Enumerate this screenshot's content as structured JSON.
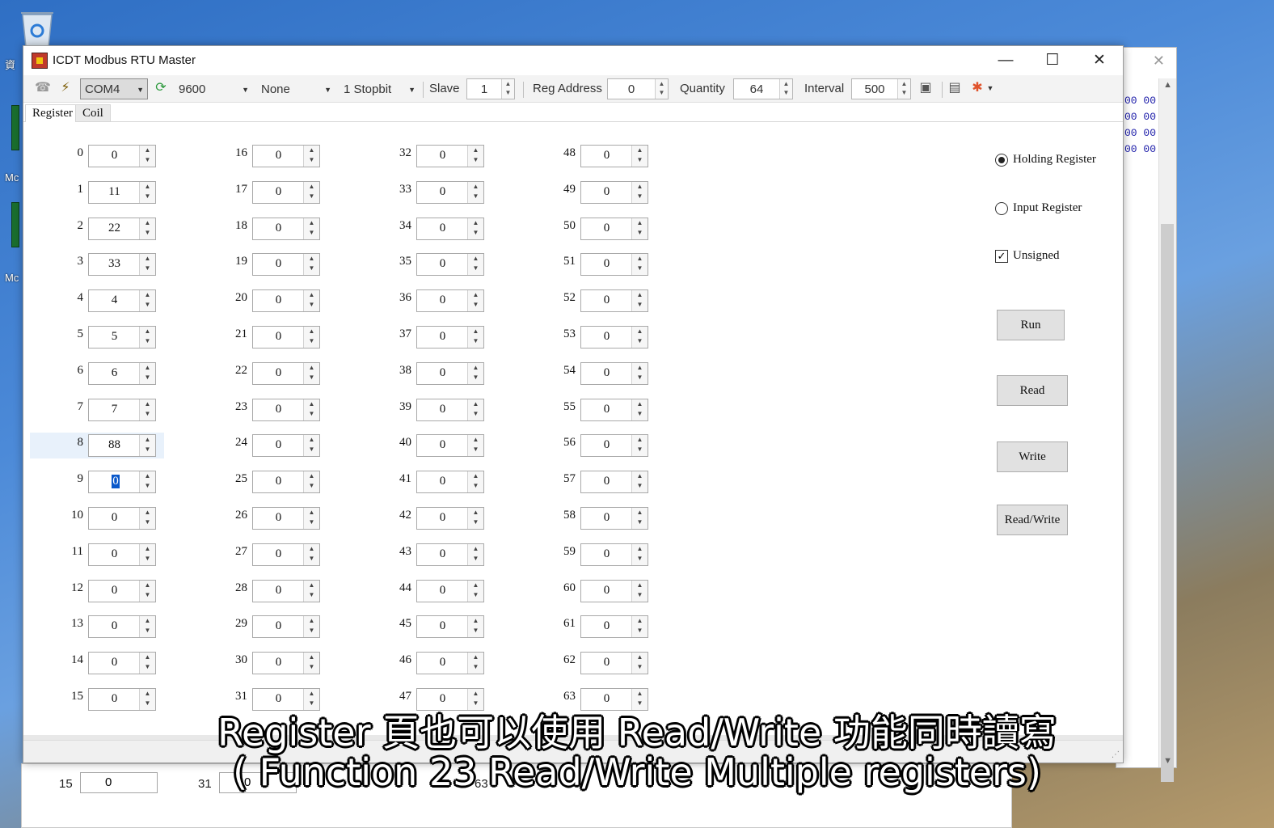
{
  "desktop": {
    "labels": [
      "資",
      "Mc",
      "Mc"
    ]
  },
  "bg_window": {
    "hex_lines": [
      "00 00",
      "00 00",
      "00 00",
      "00 00"
    ]
  },
  "behind_window": {
    "label_a": "15",
    "value_a": "0",
    "label_b": "31",
    "value_b": "0",
    "label_c": "63"
  },
  "window": {
    "title": "ICDT Modbus RTU Master",
    "controls": {
      "minimize": "—",
      "maximize": "☐",
      "close": "✕"
    }
  },
  "toolbar": {
    "port": "COM4",
    "baud": "9600",
    "parity": "None",
    "stopbit": "1 Stopbit",
    "slave_label": "Slave",
    "slave_value": "1",
    "reg_address_label": "Reg Address",
    "reg_address_value": "0",
    "quantity_label": "Quantity",
    "quantity_value": "64",
    "interval_label": "Interval",
    "interval_value": "500"
  },
  "tabs": [
    {
      "label": "Register",
      "active": true
    },
    {
      "label": "Coil",
      "active": false
    }
  ],
  "registers": [
    {
      "addr": "0",
      "value": "0"
    },
    {
      "addr": "1",
      "value": "11"
    },
    {
      "addr": "2",
      "value": "22"
    },
    {
      "addr": "3",
      "value": "33"
    },
    {
      "addr": "4",
      "value": "4"
    },
    {
      "addr": "5",
      "value": "5"
    },
    {
      "addr": "6",
      "value": "6"
    },
    {
      "addr": "7",
      "value": "7"
    },
    {
      "addr": "8",
      "value": "88"
    },
    {
      "addr": "9",
      "value": "0"
    },
    {
      "addr": "10",
      "value": "0"
    },
    {
      "addr": "11",
      "value": "0"
    },
    {
      "addr": "12",
      "value": "0"
    },
    {
      "addr": "13",
      "value": "0"
    },
    {
      "addr": "14",
      "value": "0"
    },
    {
      "addr": "15",
      "value": "0"
    },
    {
      "addr": "16",
      "value": "0"
    },
    {
      "addr": "17",
      "value": "0"
    },
    {
      "addr": "18",
      "value": "0"
    },
    {
      "addr": "19",
      "value": "0"
    },
    {
      "addr": "20",
      "value": "0"
    },
    {
      "addr": "21",
      "value": "0"
    },
    {
      "addr": "22",
      "value": "0"
    },
    {
      "addr": "23",
      "value": "0"
    },
    {
      "addr": "24",
      "value": "0"
    },
    {
      "addr": "25",
      "value": "0"
    },
    {
      "addr": "26",
      "value": "0"
    },
    {
      "addr": "27",
      "value": "0"
    },
    {
      "addr": "28",
      "value": "0"
    },
    {
      "addr": "29",
      "value": "0"
    },
    {
      "addr": "30",
      "value": "0"
    },
    {
      "addr": "31",
      "value": "0"
    },
    {
      "addr": "32",
      "value": "0"
    },
    {
      "addr": "33",
      "value": "0"
    },
    {
      "addr": "34",
      "value": "0"
    },
    {
      "addr": "35",
      "value": "0"
    },
    {
      "addr": "36",
      "value": "0"
    },
    {
      "addr": "37",
      "value": "0"
    },
    {
      "addr": "38",
      "value": "0"
    },
    {
      "addr": "39",
      "value": "0"
    },
    {
      "addr": "40",
      "value": "0"
    },
    {
      "addr": "41",
      "value": "0"
    },
    {
      "addr": "42",
      "value": "0"
    },
    {
      "addr": "43",
      "value": "0"
    },
    {
      "addr": "44",
      "value": "0"
    },
    {
      "addr": "45",
      "value": "0"
    },
    {
      "addr": "46",
      "value": "0"
    },
    {
      "addr": "47",
      "value": "0"
    },
    {
      "addr": "48",
      "value": "0"
    },
    {
      "addr": "49",
      "value": "0"
    },
    {
      "addr": "50",
      "value": "0"
    },
    {
      "addr": "51",
      "value": "0"
    },
    {
      "addr": "52",
      "value": "0"
    },
    {
      "addr": "53",
      "value": "0"
    },
    {
      "addr": "54",
      "value": "0"
    },
    {
      "addr": "55",
      "value": "0"
    },
    {
      "addr": "56",
      "value": "0"
    },
    {
      "addr": "57",
      "value": "0"
    },
    {
      "addr": "58",
      "value": "0"
    },
    {
      "addr": "59",
      "value": "0"
    },
    {
      "addr": "60",
      "value": "0"
    },
    {
      "addr": "61",
      "value": "0"
    },
    {
      "addr": "62",
      "value": "0"
    },
    {
      "addr": "63",
      "value": "0"
    }
  ],
  "selected_register": "8",
  "editing_register": "9",
  "options": {
    "holding_register": "Holding Register",
    "input_register": "Input Register",
    "unsigned": "Unsigned",
    "selected_type": "holding_register",
    "unsigned_checked": true
  },
  "buttons": {
    "run": "Run",
    "read": "Read",
    "write": "Write",
    "read_write": "Read/Write"
  },
  "subtitle": {
    "line1": "Register 頁也可以使用 Read/Write 功能同時讀寫",
    "line2": "( Function 23 Read/Write Multiple registers)"
  },
  "colors": {
    "accent": "#0a58ca",
    "hex_text": "#1a1aa8"
  }
}
